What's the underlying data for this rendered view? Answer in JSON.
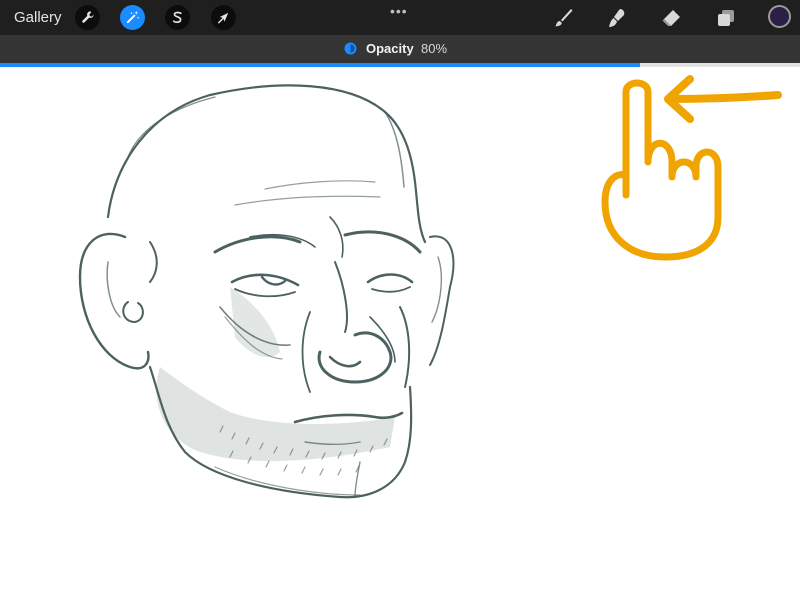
{
  "toolbar": {
    "gallery_label": "Gallery",
    "left_tools": [
      "wrench-icon",
      "magic-wand-icon",
      "selection-s-icon",
      "transform-arrow-icon"
    ],
    "active_tool": "magic-wand-icon",
    "more_label": "•••",
    "right_tools": [
      "brush-icon",
      "smudge-icon",
      "eraser-icon",
      "layers-icon"
    ],
    "current_color": "#2b1f45"
  },
  "adjustment": {
    "label": "Opacity",
    "value_text": "80%",
    "value": 80,
    "accent": "#1a8cff"
  },
  "gesture": {
    "description_icon": "swipe-left-finger-icon",
    "color": "#f0a400"
  }
}
